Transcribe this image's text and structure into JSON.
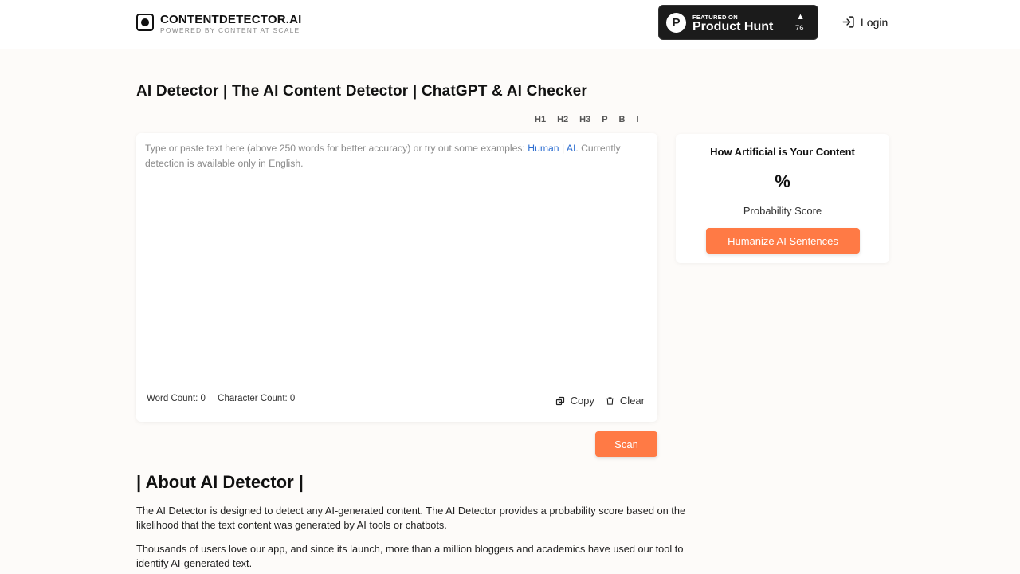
{
  "header": {
    "logo_name": "CONTENTDETECTOR.AI",
    "logo_tagline": "POWERED BY CONTENT AT SCALE",
    "producthunt": {
      "small_label": "FEATURED ON",
      "big_label": "Product Hunt",
      "arrow": "▲",
      "count": "76"
    },
    "login_label": "Login"
  },
  "page_title": "AI Detector | The AI Content Detector | ChatGPT & AI Checker",
  "toolbar": {
    "h1": "H1",
    "h2": "H2",
    "h3": "H3",
    "p": "P",
    "b": "B",
    "i": "I"
  },
  "editor": {
    "placeholder_before": "Type or paste text here (above 250 words for better accuracy) or try out some examples: ",
    "example_human": "Human",
    "separator": " | ",
    "example_ai": "AI",
    "placeholder_after": ". Currently detection is available only in English.",
    "word_count": "Word Count: 0",
    "char_count": "Character Count: 0",
    "copy_label": "Copy",
    "clear_label": "Clear"
  },
  "score_card": {
    "title": "How Artificial is Your Content",
    "percent": "%",
    "label": "Probability Score",
    "humanize_label": "Humanize AI Sentences"
  },
  "scan_label": "Scan",
  "about": {
    "title": "| About AI Detector |",
    "p1": "The AI Detector is designed to detect any AI-generated content. The AI Detector provides a probability score based on the likelihood that the text content was generated by AI tools or chatbots.",
    "p2": "Thousands of users love our app, and since its launch, more than a million bloggers and academics have used our tool to identify AI-generated text."
  },
  "colors": {
    "accent": "#ff7a45",
    "link": "#2f6fd1",
    "background": "#fdfbf9"
  }
}
